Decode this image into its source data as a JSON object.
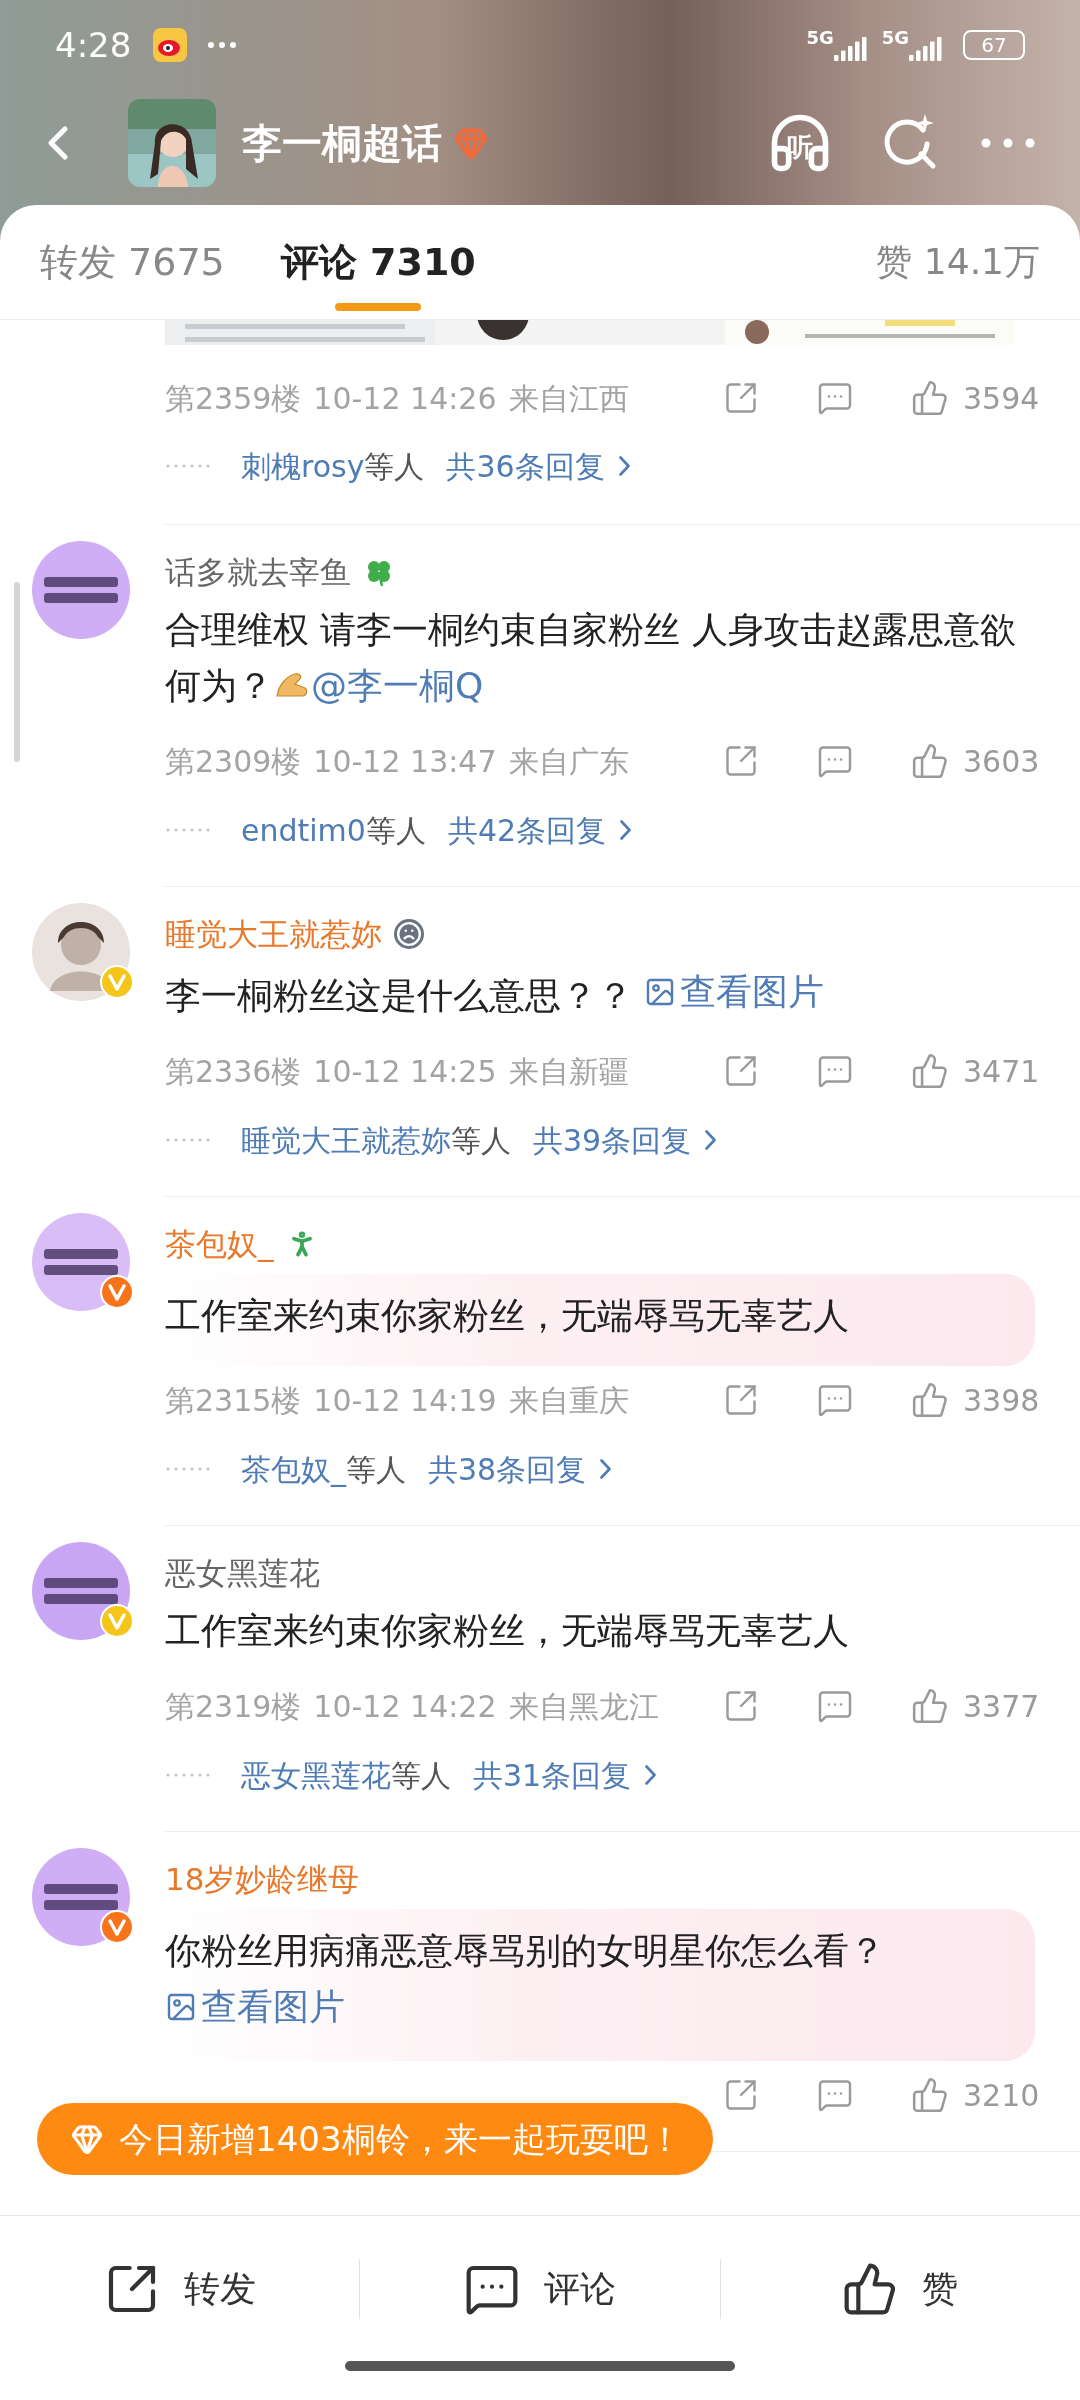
{
  "status_bar": {
    "time": "4:28",
    "networks": [
      "5G",
      "5G"
    ],
    "battery": "67"
  },
  "header": {
    "title": "李一桐超话",
    "listen_label": "听"
  },
  "tabs": [
    {
      "label": "转发 7675",
      "selected": false
    },
    {
      "label": "评论 7310",
      "selected": true
    }
  ],
  "likes_tab": "赞 14.1万",
  "comments": [
    {
      "kind": "partial",
      "floor": "第2359楼",
      "time": "10-12 14:26",
      "location": "来自江西",
      "likes": "3594",
      "replies": {
        "by": "刺槐rosy",
        "suffix": "等人",
        "total": "共36条回复"
      }
    },
    {
      "kind": "full",
      "avatar": {
        "kind": "emblem",
        "color": "#cfaef5"
      },
      "name": "话多就去宰鱼",
      "name_highlight": false,
      "name_icon": {
        "kind": "clover"
      },
      "bubble": false,
      "segments": [
        {
          "kind": "text",
          "text": "合理维权 请李一桐约束自家粉丝 人身攻击赵露思意欲何为？"
        },
        {
          "kind": "emoji"
        },
        {
          "kind": "link",
          "text": "@李一桐Q"
        }
      ],
      "floor": "第2309楼",
      "time": "10-12 13:47",
      "location": "来自广东",
      "likes": "3603",
      "replies": {
        "by": "endtim0",
        "suffix": "等人",
        "total": "共42条回复"
      }
    },
    {
      "kind": "full",
      "avatar": {
        "kind": "silhouette",
        "color": "#e9e2de"
      },
      "badge": {
        "color": "#f5c518"
      },
      "name": "睡觉大王就惹妳",
      "name_highlight": true,
      "name_icon": {
        "kind": "sad"
      },
      "bubble": false,
      "segments": [
        {
          "kind": "text",
          "text": "李一桐粉丝这是什么意思？？ "
        },
        {
          "kind": "image_link",
          "text": "查看图片"
        }
      ],
      "floor": "第2336楼",
      "time": "10-12 14:25",
      "location": "来自新疆",
      "likes": "3471",
      "replies": {
        "by": "睡觉大王就惹妳",
        "suffix": "等人",
        "total": "共39条回复"
      }
    },
    {
      "kind": "full",
      "avatar": {
        "kind": "emblem",
        "color": "#d9bdf7"
      },
      "badge": {
        "color": "#f7741a"
      },
      "name": "茶包奴_",
      "name_highlight": true,
      "name_icon": {
        "kind": "figure"
      },
      "bubble": true,
      "segments": [
        {
          "kind": "text",
          "text": "工作室来约束你家粉丝，无端辱骂无辜艺人"
        }
      ],
      "floor": "第2315楼",
      "time": "10-12 14:19",
      "location": "来自重庆",
      "likes": "3398",
      "replies": {
        "by": "茶包奴_",
        "suffix": "等人",
        "total": "共38条回复"
      }
    },
    {
      "kind": "full",
      "avatar": {
        "kind": "emblem",
        "color": "#c9a6f3"
      },
      "badge": {
        "color": "#f5c518"
      },
      "name": "恶女黑莲花",
      "name_highlight": false,
      "bubble": false,
      "segments": [
        {
          "kind": "text",
          "text": "工作室来约束你家粉丝，无端辱骂无辜艺人"
        }
      ],
      "floor": "第2319楼",
      "time": "10-12 14:22",
      "location": "来自黑龙江",
      "likes": "3377",
      "replies": {
        "by": "恶女黑莲花",
        "suffix": "等人",
        "total": "共31条回复"
      }
    },
    {
      "kind": "full",
      "avatar": {
        "kind": "emblem",
        "color": "#cfaef5"
      },
      "badge": {
        "color": "#f7741a"
      },
      "name": "18岁妙龄继母",
      "name_highlight": true,
      "bubble": true,
      "segments": [
        {
          "kind": "text",
          "text": "你粉丝用病痛恶意辱骂别的女明星你怎么看？ "
        },
        {
          "kind": "image_link",
          "text": "查看图片"
        }
      ],
      "likes": "3210"
    }
  ],
  "banner": {
    "text": "今日新增1403桐铃，来一起玩耍吧！"
  },
  "actions": [
    {
      "kind": "share",
      "label": "转发"
    },
    {
      "kind": "comment",
      "label": "评论"
    },
    {
      "kind": "like",
      "label": "赞"
    }
  ]
}
